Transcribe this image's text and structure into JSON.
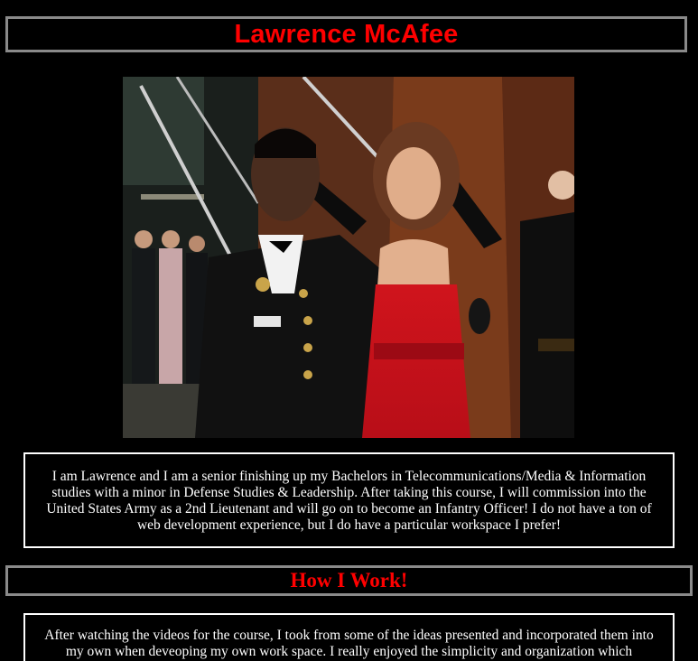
{
  "header": {
    "title": "Lawrence McAfee"
  },
  "photo": {
    "description_icon": "portrait-photo"
  },
  "bio": {
    "text": "I am Lawrence and I am a senior finishing up my Bachelors in Telecommunications/Media & Information studies with a minor in Defense Studies & Leadership. After taking this course, I will commission into the United States Army as a 2nd Lieutenant and will go on to become an Infantry Officer! I do not have a ton of web development experience, but I do have a particular workspace I prefer!"
  },
  "work_section": {
    "title": "How I Work!",
    "text": "After watching the videos for the course, I took from some of the ideas presented and incorporated them into my own when deveoping my own work space. I really enjoyed the simplicity and organization which"
  },
  "colors": {
    "background": "#000000",
    "heading": "#ff0000",
    "banner_border": "#8a8a8a",
    "box_border": "#ffffff",
    "text": "#ffffff"
  }
}
